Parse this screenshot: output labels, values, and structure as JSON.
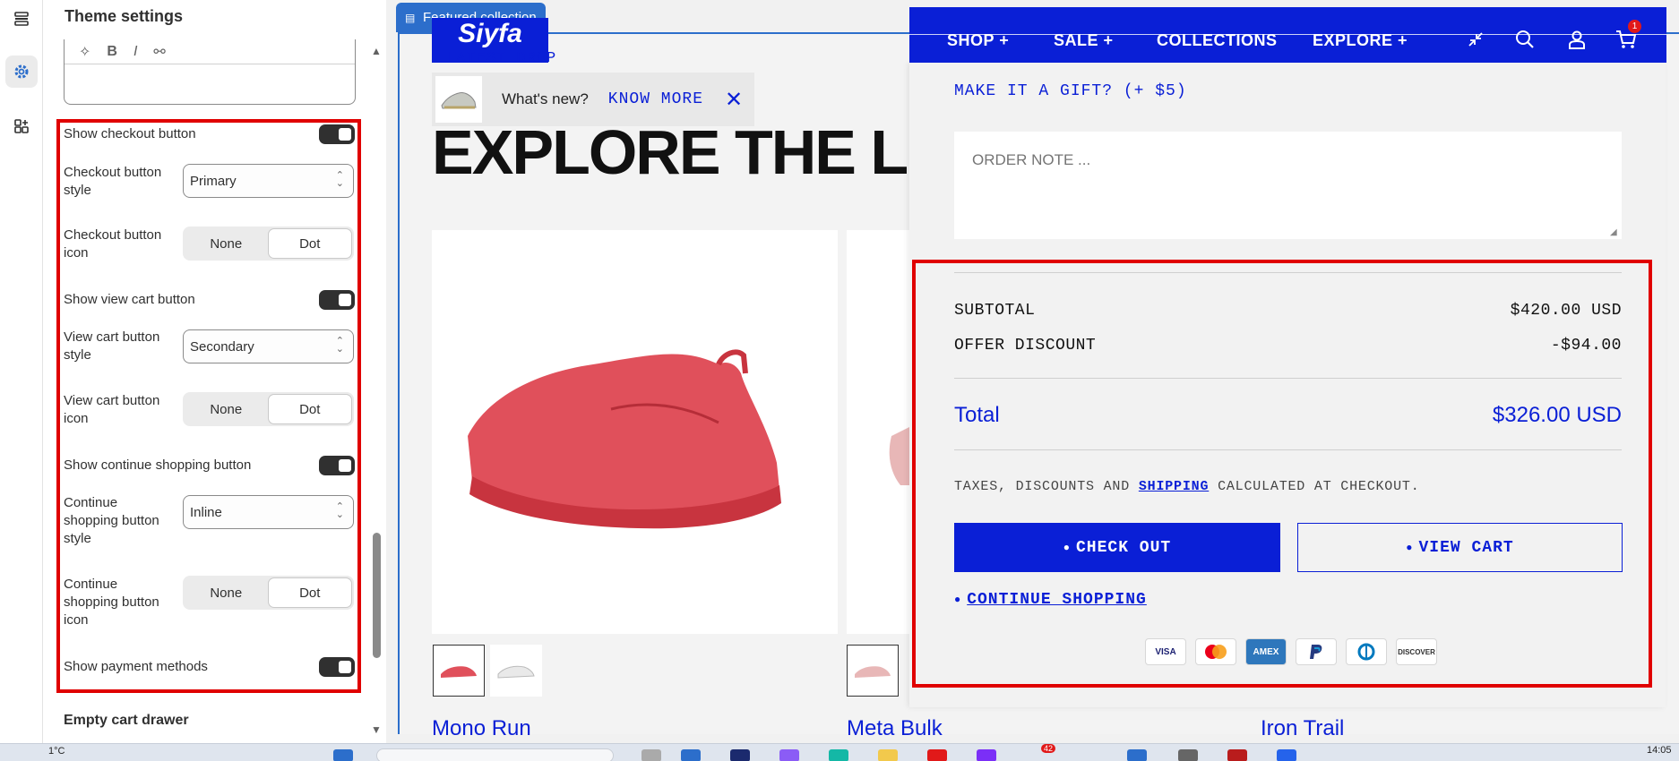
{
  "settings": {
    "title": "Theme settings",
    "rows": {
      "show_checkout": "Show checkout button",
      "checkout_style_label": "Checkout button style",
      "checkout_style_value": "Primary",
      "checkout_icon_label": "Checkout button icon",
      "show_view_cart": "Show view cart button",
      "view_cart_style_label": "View cart button style",
      "view_cart_style_value": "Secondary",
      "view_cart_icon_label": "View cart button icon",
      "show_continue": "Show continue shopping button",
      "continue_style_label": "Continue shopping button style",
      "continue_style_value": "Inline",
      "continue_icon_label": "Continue shopping button icon",
      "show_payment": "Show payment methods"
    },
    "segment": {
      "none": "None",
      "dot": "Dot"
    },
    "section_empty_cart": "Empty cart drawer"
  },
  "preview": {
    "featured_tag": "Featured collection",
    "logo": "Siyfa",
    "latest_drop": "LATEST DROP",
    "whats_new": "What's new?",
    "know_more": "KNOW MORE",
    "hero": "EXPLORE THE LINE",
    "products": [
      "Mono Run",
      "Meta Bulk",
      "Iron Trail"
    ]
  },
  "nav": {
    "items": [
      "SHOP +",
      "SALE +",
      "COLLECTIONS",
      "EXPLORE +"
    ],
    "cart_count": "1"
  },
  "cart": {
    "gift": "MAKE IT A GIFT? (+ $5)",
    "order_note_placeholder": "ORDER NOTE ...",
    "subtotal_label": "SUBTOTAL",
    "subtotal_value": "$420.00 USD",
    "discount_label": "OFFER DISCOUNT",
    "discount_value": "-$94.00",
    "total_label": "Total",
    "total_value": "$326.00 USD",
    "taxes_before": "TAXES, DISCOUNTS AND",
    "taxes_link": "SHIPPING",
    "taxes_after": "CALCULATED AT CHECKOUT.",
    "checkout": "CHECK OUT",
    "view_cart": "VIEW CART",
    "continue": "CONTINUE SHOPPING",
    "payments": [
      "VISA",
      "MC",
      "AMEX",
      "PayPal",
      "Diners",
      "DISCOVER"
    ]
  },
  "taskbar": {
    "temp": "1°C",
    "time": "14:05",
    "badge": "42"
  },
  "colors": {
    "brand_blue": "#0a1fd6",
    "highlight_red": "#e00000",
    "editor_blue": "#2c6ecb"
  }
}
